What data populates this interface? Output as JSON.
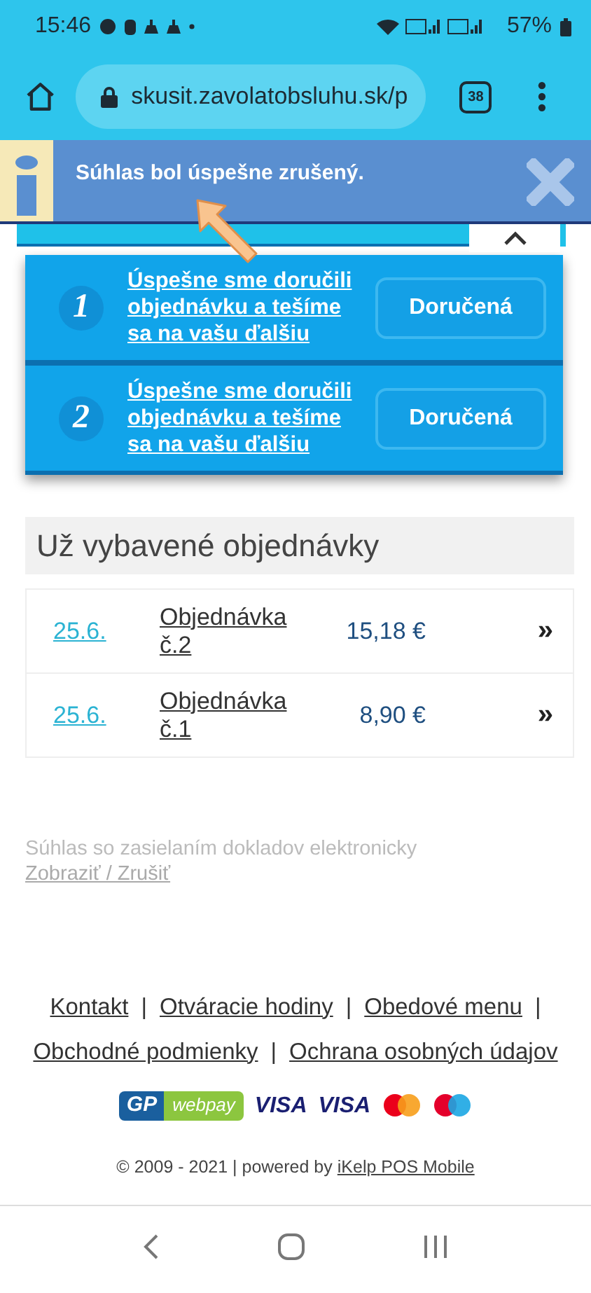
{
  "status_bar": {
    "time": "15:46",
    "battery": "57%"
  },
  "browser": {
    "url": "skusit.zavolatobsluhu.sk/p",
    "tab_count": "38"
  },
  "notification": {
    "message": "Súhlas bol úspešne zrušený."
  },
  "orders_panel": {
    "items": [
      {
        "number": "1",
        "message": "Úspešne sme doručili objednávku a tešíme sa na vašu ďalšiu",
        "status": "Doručená"
      },
      {
        "number": "2",
        "message": "Úspešne sme doručili objednávku a tešíme sa na vašu ďalšiu",
        "status": "Doručená"
      }
    ]
  },
  "completed_orders": {
    "title": "Už vybavené objednávky",
    "rows": [
      {
        "date": "25.6.",
        "order": "Objednávka č.2",
        "amount": "15,18 €",
        "open": "»"
      },
      {
        "date": "25.6.",
        "order": "Objednávka č.1",
        "amount": "8,90 €",
        "open": "»"
      }
    ]
  },
  "consent": {
    "text": "Súhlas so zasielaním dokladov elektronicky",
    "link": "Zobraziť / Zrušiť"
  },
  "footer": {
    "lines": [
      [
        {
          "label": "Kontakt",
          "separator": "|"
        },
        {
          "label": "Otváracie hodiny",
          "separator": "|"
        },
        {
          "label": "Obedové menu",
          "separator": "|"
        }
      ],
      [
        {
          "label": "Obchodné podmienky",
          "separator": "|"
        },
        {
          "label": "Ochrana osobných údajov"
        }
      ]
    ],
    "payments": {
      "gp": "GP",
      "webpay": "webpay",
      "visa": [
        "VISA",
        "VISA"
      ]
    },
    "copyright": "© 2009 - 2021 | powered by",
    "powered_link": "iKelp POS Mobile"
  }
}
